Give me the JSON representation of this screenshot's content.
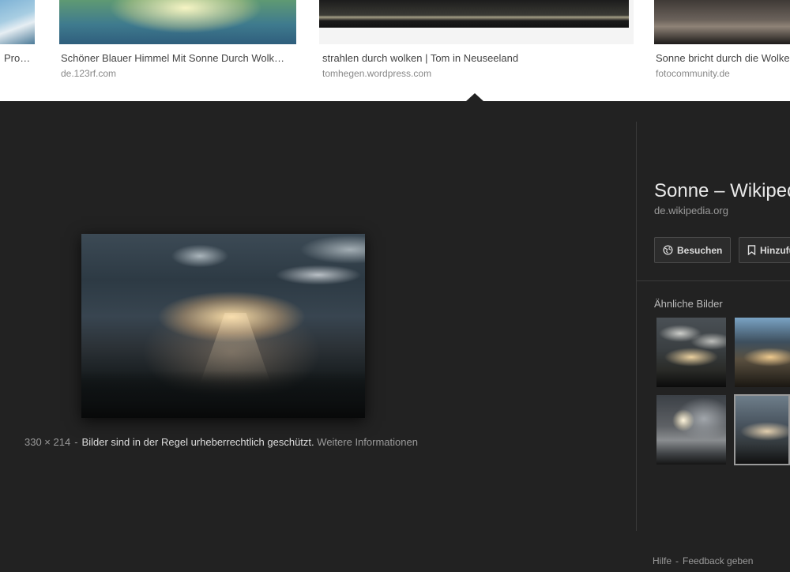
{
  "results": [
    {
      "title": "Pro…",
      "source": ""
    },
    {
      "title": "Schöner Blauer Himmel Mit Sonne Durch Wolk…",
      "source": "de.123rf.com"
    },
    {
      "title": "strahlen durch wolken | Tom in Neuseeland",
      "source": "tomhegen.wordpress.com"
    },
    {
      "title": "Sonne bricht durch die Wolke",
      "source": "fotocommunity.de"
    }
  ],
  "preview": {
    "dimensions": "330 × 214",
    "separator": "-",
    "rights_text": "Bilder sind in der Regel urheberrechtlich geschützt.",
    "more_info_link": "Weitere Informationen"
  },
  "side_panel": {
    "title": "Sonne – Wikipedia",
    "domain": "de.wikipedia.org",
    "visit_button": "Besuchen",
    "save_button": "Hinzufügen",
    "similar_label": "Ähnliche Bilder"
  },
  "footer": {
    "help": "Hilfe",
    "separator": "-",
    "feedback": "Feedback geben"
  },
  "colors": {
    "background": "#222222",
    "strip_background": "#ffffff"
  }
}
